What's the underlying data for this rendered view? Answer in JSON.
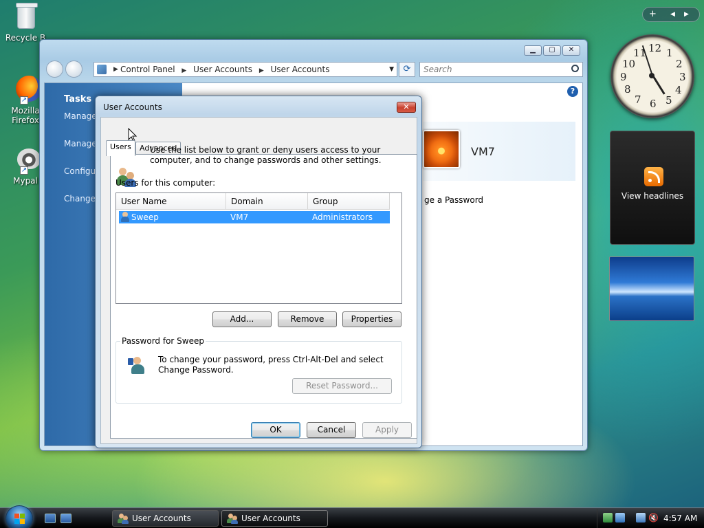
{
  "desktop": {
    "icons": [
      {
        "label": "Recycle B"
      },
      {
        "label": "Mozilla Firefox"
      },
      {
        "label": "Mypal"
      }
    ]
  },
  "sidebar": {
    "clock_numbers": [
      "12",
      "1",
      "2",
      "3",
      "4",
      "5",
      "6",
      "7",
      "8",
      "9",
      "10",
      "11"
    ],
    "feed_label": "View headlines"
  },
  "control_panel": {
    "address": {
      "segments": [
        "Control Panel",
        "User Accounts",
        "User Accounts"
      ]
    },
    "search_placeholder": "Search",
    "tasks_title": "Tasks",
    "tasks": [
      "Manage passwords",
      "Manage certificates",
      "Configure profile p",
      "Change variables"
    ],
    "user_name": "VM7",
    "change_password_link": "ge a Password"
  },
  "dialog": {
    "title": "User Accounts",
    "tabs": [
      "Users",
      "Advanced"
    ],
    "intro_text": "Use the list below to grant or deny users access to your computer, and to change passwords and other settings.",
    "list_label": "Users for this computer:",
    "columns": [
      "User Name",
      "Domain",
      "Group"
    ],
    "rows": [
      {
        "user": "Sweep",
        "domain": "VM7",
        "group": "Administrators",
        "selected": true
      }
    ],
    "buttons": {
      "add": "Add...",
      "remove": "Remove",
      "properties": "Properties"
    },
    "password_group": {
      "title": "Password for Sweep",
      "text": "To change your password, press Ctrl-Alt-Del and select Change Password.",
      "reset_button": "Reset Password..."
    },
    "footer": {
      "ok": "OK",
      "cancel": "Cancel",
      "apply": "Apply"
    }
  },
  "taskbar": {
    "tasks": [
      "User Accounts",
      "User Accounts"
    ],
    "time": "4:57 AM"
  },
  "colors": {
    "selection": "#3399ff",
    "close_red": "#c8402e",
    "tasks_blue": "#2e6aa8"
  }
}
